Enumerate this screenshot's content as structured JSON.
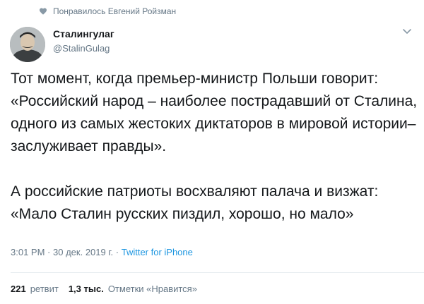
{
  "social_context": {
    "icon": "heart-icon",
    "text": "Понравилось Евгений Ройзман"
  },
  "author": {
    "display_name": "Сталингулаг",
    "handle": "@StalinGulag",
    "avatar_icon": "avatar"
  },
  "tweet": {
    "paragraphs": [
      "Тот момент, когда премьер-министр Польши говорит: «Российский народ – наиболее пострадавший от Сталина, одного из самых жестоких диктаторов в мировой истории– заслуживает правды».",
      "А российские патриоты восхваляют палача и визжат: «Мало Сталин русских пиздил, хорошо, но мало»"
    ],
    "time": "3:01 PM",
    "separator": "·",
    "date": "30 дек. 2019 г.",
    "source": "Twitter for iPhone"
  },
  "stats": {
    "retweets_count": "221",
    "retweets_label": "ретвит",
    "likes_count": "1,3 тыс.",
    "likes_label": "Отметки «Нравится»"
  },
  "colors": {
    "text": "#14171a",
    "secondary": "#657786",
    "link": "#1b95e0",
    "divider": "#e6ecf0"
  }
}
